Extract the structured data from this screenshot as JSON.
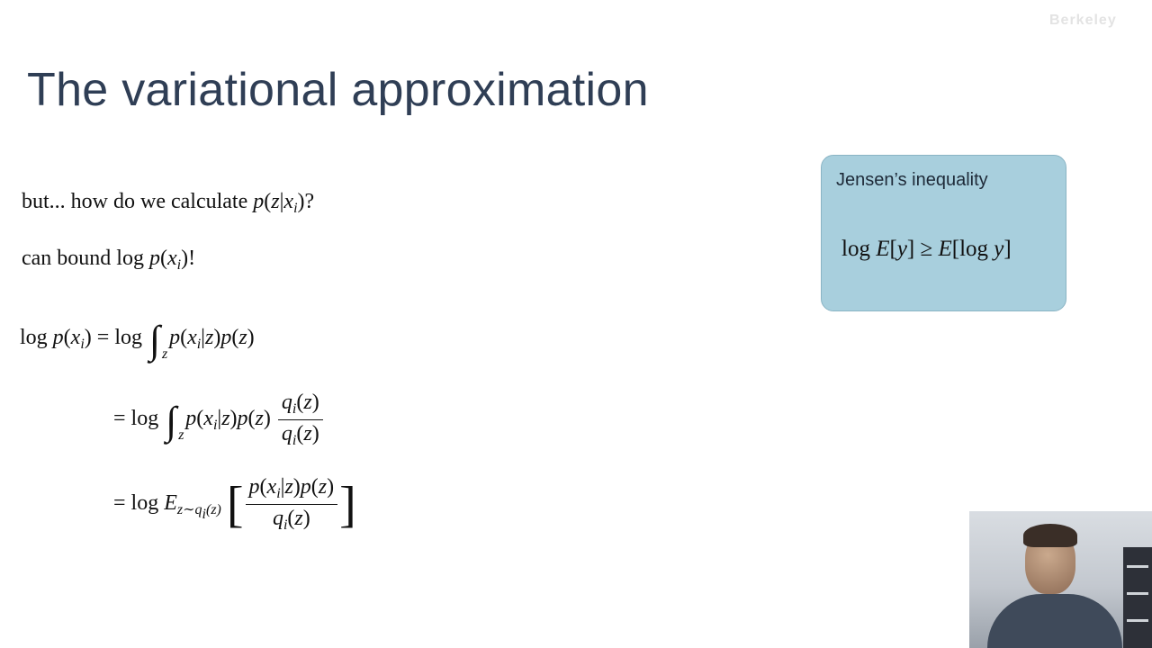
{
  "slide": {
    "title": "The variational approximation",
    "watermark": "Berkeley"
  },
  "body": {
    "line1": {
      "text": "but... how do we calculate",
      "expr_func": "p",
      "expr_open": "(",
      "expr_var1": "z",
      "expr_bar": "|",
      "expr_var2": "x",
      "expr_sub": "i",
      "expr_close": ")?"
    },
    "line2": {
      "text": "can bound log",
      "expr_func": "p",
      "expr_open": "(",
      "expr_var": "x",
      "expr_sub": "i",
      "expr_close": ")!"
    }
  },
  "equations": {
    "eq1": {
      "lhs_log": "log",
      "lhs_p": "p",
      "lhs_x": "x",
      "lhs_sub": "i",
      "rel": "=",
      "log": "log",
      "int_var": "z",
      "integrand_p1": "p",
      "integrand_x": "x",
      "integrand_sub": "i",
      "integrand_z": "z",
      "integrand_p2": "p",
      "integrand_z2": "z"
    },
    "eq2": {
      "rel": "=",
      "log": "log",
      "int_var": "z",
      "num_q": "q",
      "num_sub": "i",
      "num_z": "z",
      "den_q": "q",
      "den_sub": "i",
      "den_z": "z"
    },
    "eq3": {
      "rel": "=",
      "log": "log",
      "E": "E",
      "E_sub": "z∼q",
      "E_sub_i": "i",
      "E_sub_z": "(z)",
      "lb": "[",
      "rb": "]"
    }
  },
  "jensen": {
    "title": "Jensen’s inequality",
    "eq_log1": "log",
    "eq_E1": "E",
    "eq_y1": "y",
    "eq_rel": "≥",
    "eq_E2": "E",
    "eq_log2": "log",
    "eq_y2": "y"
  },
  "colors": {
    "title": "#2f3e55",
    "box_fill": "#a8cfdd",
    "box_border": "#8ab4c4"
  }
}
